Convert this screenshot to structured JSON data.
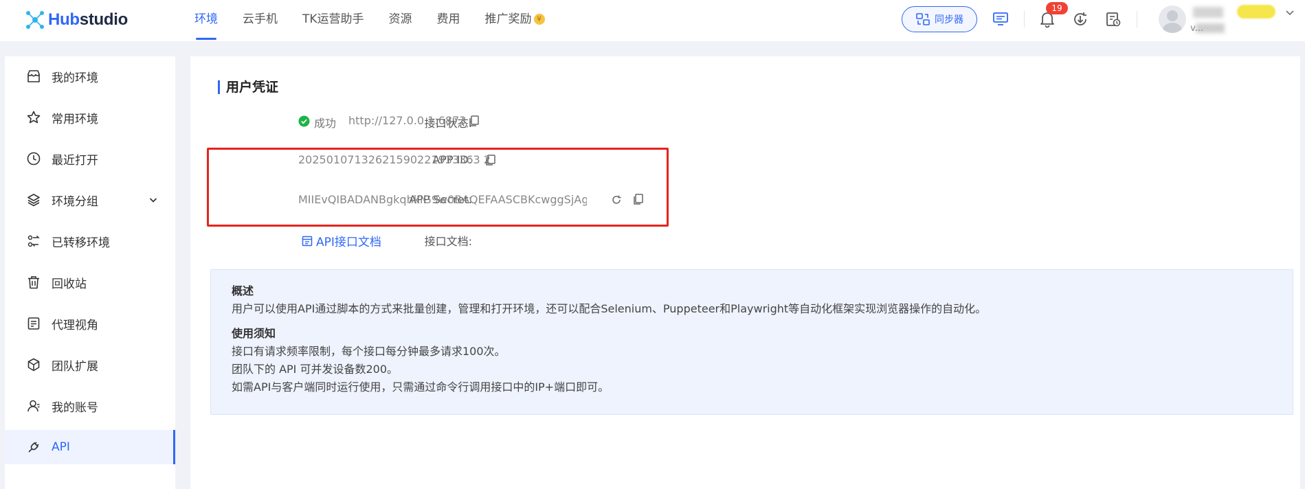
{
  "header": {
    "logo_text": "Hubstudio",
    "nav": [
      "环境",
      "云手机",
      "TK运营助手",
      "资源",
      "费用",
      "推广奖励"
    ],
    "active_nav": "环境",
    "sync_label": "同步器",
    "notification_count": "19",
    "user_name": "v..."
  },
  "sidebar": {
    "items": [
      {
        "label": "我的环境",
        "icon": "store-icon"
      },
      {
        "label": "常用环境",
        "icon": "star-icon"
      },
      {
        "label": "最近打开",
        "icon": "clock-icon"
      },
      {
        "label": "环境分组",
        "icon": "layers-icon"
      },
      {
        "label": "已转移环境",
        "icon": "transfer-icon"
      },
      {
        "label": "回收站",
        "icon": "trash-icon"
      },
      {
        "label": "代理视角",
        "icon": "proxy-icon"
      },
      {
        "label": "团队扩展",
        "icon": "cube-icon"
      },
      {
        "label": "我的账号",
        "icon": "user-icon"
      },
      {
        "label": "API",
        "icon": "plug-icon"
      }
    ],
    "active": "API"
  },
  "credentials": {
    "title": "用户凭证",
    "status_label": "接口状态:",
    "status_text": "成功",
    "status_url": "http://127.0.0.1:6873",
    "app_id_label": "APP ID:",
    "app_id_value": "20250107132621590221933363 2",
    "app_secret_label": "APP Secret:",
    "app_secret_value": "MIIEvQIBADANBgkqhkiG9w0BAQEFAASCBKcwggSjAgE...",
    "doc_label": "接口文档:",
    "doc_link": "API接口文档"
  },
  "info": {
    "overview_title": "概述",
    "overview_text": "用户可以使用API通过脚本的方式来批量创建，管理和打开环境，还可以配合Selenium、Puppeteer和Playwright等自动化框架实现浏览器操作的自动化。",
    "notice_title": "使用须知",
    "notice_lines": [
      "接口有请求频率限制，每个接口每分钟最多请求100次。",
      "团队下的 API 可并发设备数200。",
      "如需API与客户端同时运行使用，只需通过命令行调用接口中的IP+端口即可。"
    ]
  },
  "colors": {
    "accent": "#2f67f6",
    "success": "#1db347",
    "highlight_box": "#e5231d",
    "badge": "#f04134"
  }
}
